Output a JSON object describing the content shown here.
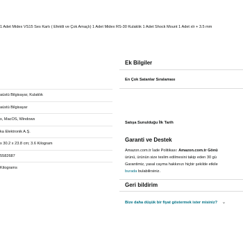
{
  "product_line": "1 Adet Midex VS15 Ses Kartı ( Efektli ve Çok Amaçlı) 1 Adet Midex RS-30 Kulaklık 1 Adet Shock Mount 1 Adet xlr + 3.5 mm",
  "details_rows": [
    "aüstü Bilgisayar, Kulaklık",
    "aüstü Bilgisayar",
    "x, MacOS, Windows",
    "ka Elektronik A.Ş.",
    "x 30.2 x 23.8 cm; 3.6 Kilogram",
    "5582687",
    "Kilograms"
  ],
  "additional_info": {
    "title": "Ek Bilgiler",
    "bestseller_label": "En Çok Satanlar Sıralaması",
    "date_first_available_label": "Satışa Sunulduğu İlk Tarih"
  },
  "warranty": {
    "title": "Garanti ve Destek",
    "line1_prefix": "Amazon.com.tr İade Politikası: ",
    "line1_bold": "Amazon.com.tr Gönü",
    "line2": "ürünü, ürünün size teslim edilmesini takip eden 30 gü",
    "line3": "Garantimiz, yasal cayma hakkınızı hiçbir şekilde etkile",
    "line4_link": "burada",
    "line4_rest": " bulabilirsiniz."
  },
  "feedback": {
    "title": "Geri bildirim",
    "link_text": "Bize daha düşük bir fiyat göstermek ister misiniz?",
    "chevron": "⌄"
  }
}
